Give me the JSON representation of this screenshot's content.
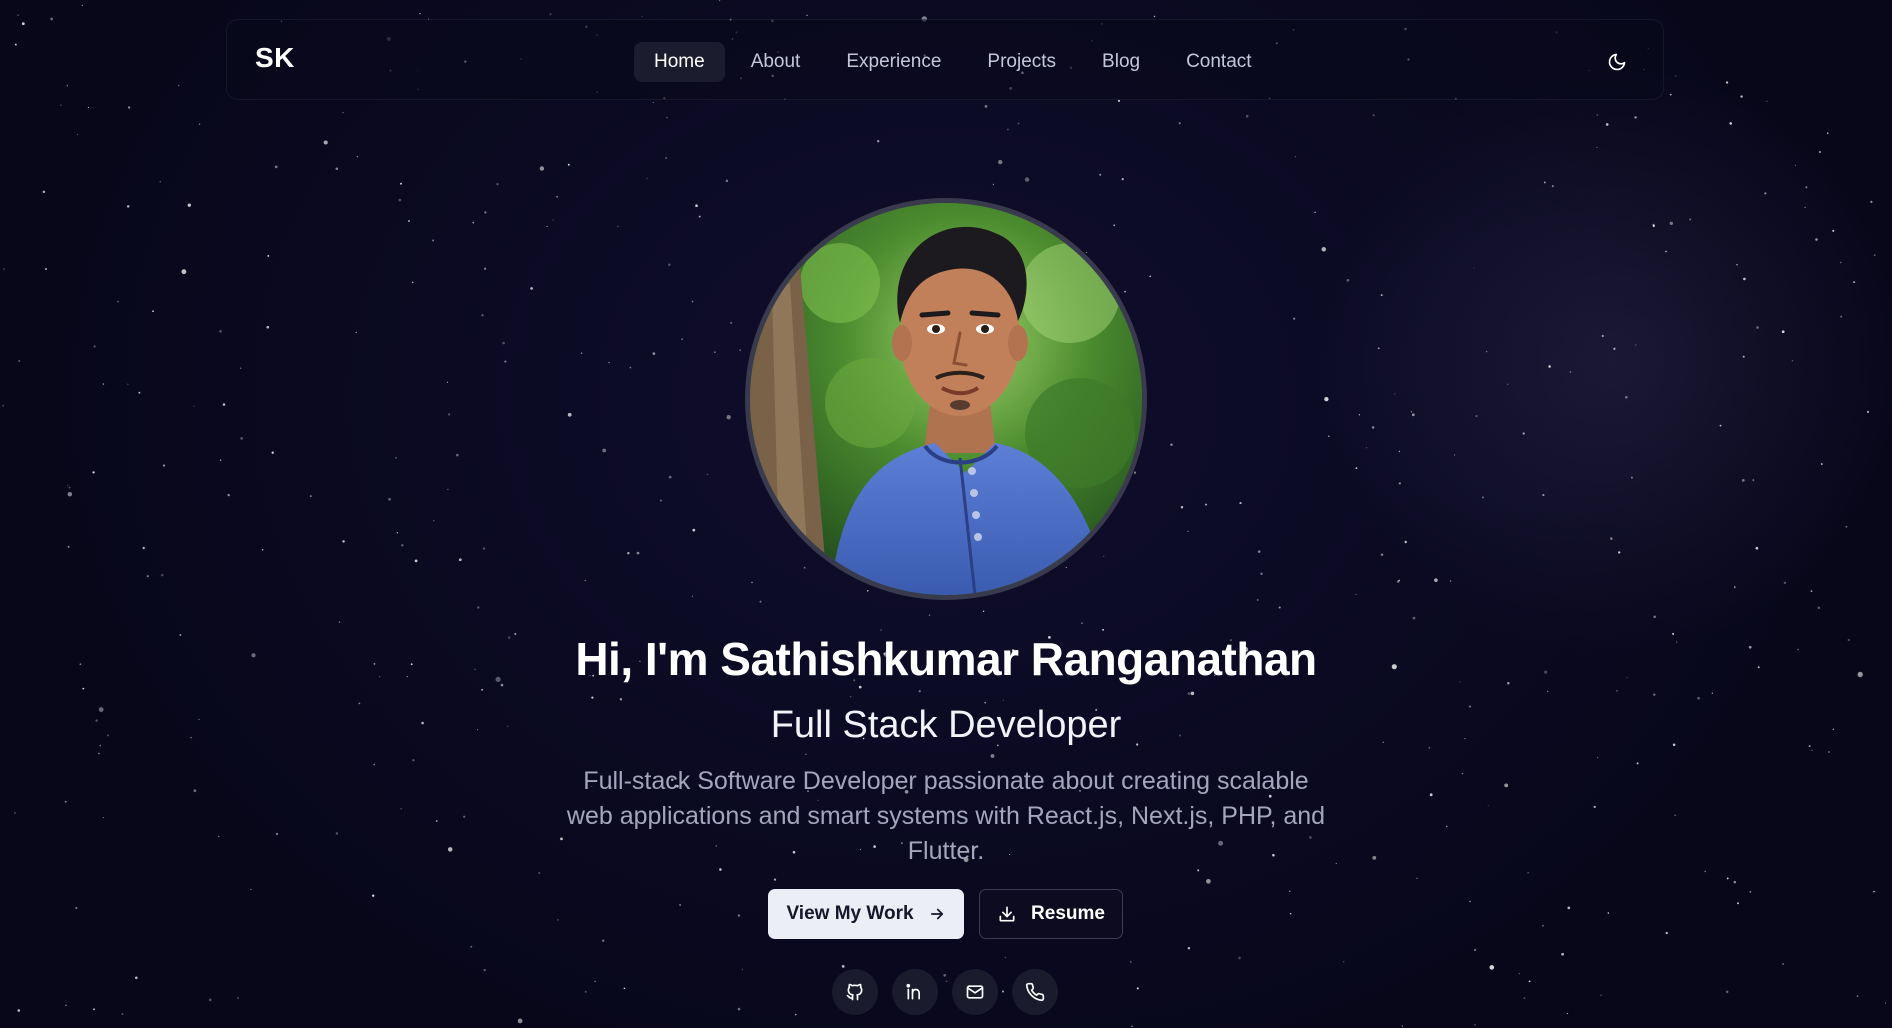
{
  "brand": {
    "logo_text": "SK"
  },
  "nav": {
    "items": [
      {
        "label": "Home",
        "active": true
      },
      {
        "label": "About",
        "active": false
      },
      {
        "label": "Experience",
        "active": false
      },
      {
        "label": "Projects",
        "active": false
      },
      {
        "label": "Blog",
        "active": false
      },
      {
        "label": "Contact",
        "active": false
      }
    ],
    "theme_toggle_icon": "moon-icon"
  },
  "hero": {
    "headline": "Hi, I'm Sathishkumar Ranganathan",
    "subheadline": "Full Stack Developer",
    "description": "Full-stack Software Developer passionate about creating scalable web applications and smart systems with React.js, Next.js, PHP, and Flutter.",
    "primary_button": {
      "label": "View My Work",
      "icon": "arrow-right-icon"
    },
    "secondary_button": {
      "label": "Resume",
      "icon": "download-icon"
    },
    "socials": [
      {
        "icon": "github-icon"
      },
      {
        "icon": "linkedin-icon"
      },
      {
        "icon": "mail-icon"
      },
      {
        "icon": "phone-icon"
      }
    ]
  },
  "colors": {
    "background": "#0b0a1f",
    "nav_active_bg": "#1b1c2d",
    "primary_button_bg": "#eceef6",
    "text_muted": "#a3a6bd"
  }
}
